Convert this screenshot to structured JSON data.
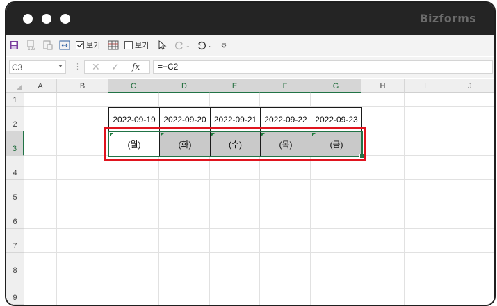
{
  "window": {
    "brand": "Bizforms"
  },
  "toolbar": {
    "view_label_1": "보기",
    "view_label_2": "보기"
  },
  "formula_bar": {
    "name_box": "C3",
    "formula": "=+C2",
    "fx_label": "fx"
  },
  "columns": [
    "A",
    "B",
    "C",
    "D",
    "E",
    "F",
    "G",
    "H",
    "I",
    "J"
  ],
  "rows": [
    "1",
    "2",
    "3",
    "4",
    "5",
    "6",
    "7",
    "8",
    "9"
  ],
  "dates": [
    "2022-09-19",
    "2022-09-20",
    "2022-09-21",
    "2022-09-22",
    "2022-09-23"
  ],
  "days": [
    "(월)",
    "(화)",
    "(수)",
    "(목)",
    "(금)"
  ],
  "colors": {
    "accent": "#217346",
    "highlight": "#e0141e",
    "titlebar": "#242424"
  }
}
